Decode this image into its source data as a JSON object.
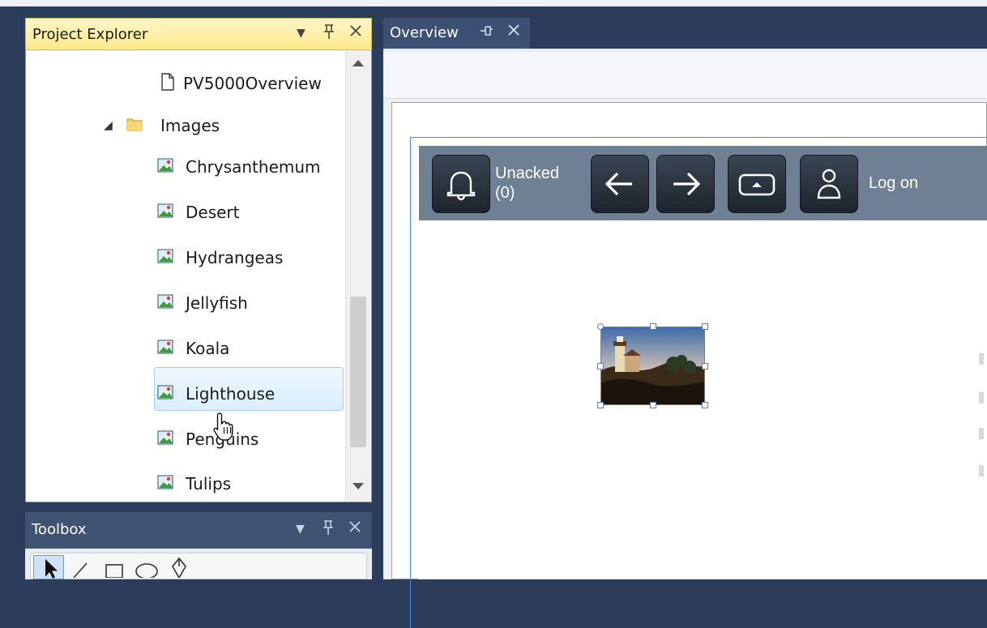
{
  "project_explorer": {
    "title": "Project Explorer",
    "buttons": {
      "dropdown": "▾",
      "pin": "ᵖ",
      "close": "×"
    },
    "items": [
      {
        "label": "PV5000Overview",
        "type": "document"
      },
      {
        "label": "Images",
        "type": "folder",
        "expanded": true
      },
      {
        "label": "Chrysanthemum",
        "type": "image"
      },
      {
        "label": "Desert",
        "type": "image"
      },
      {
        "label": "Hydrangeas",
        "type": "image"
      },
      {
        "label": "Jellyfish",
        "type": "image"
      },
      {
        "label": "Koala",
        "type": "image"
      },
      {
        "label": "Lighthouse",
        "type": "image",
        "selected": true
      },
      {
        "label": "Penguins",
        "type": "image"
      },
      {
        "label": "Tulips",
        "type": "image"
      }
    ]
  },
  "toolbox": {
    "title": "Toolbox",
    "tools": [
      "pointer-tool",
      "line-tool",
      "rectangle-tool",
      "ellipse-tool",
      "polygon-tool"
    ]
  },
  "document_tab": {
    "label": "Overview"
  },
  "hmi_toolbar": {
    "alarm_label_line1": "Unacked",
    "alarm_label_line2": "(0)",
    "logon_label": "Log on"
  },
  "colors": {
    "ide_background": "#2b3d5b",
    "active_header": "#fde98a",
    "hmi_bar": "#6f7f94",
    "selection_blue": "#4a86d4"
  }
}
